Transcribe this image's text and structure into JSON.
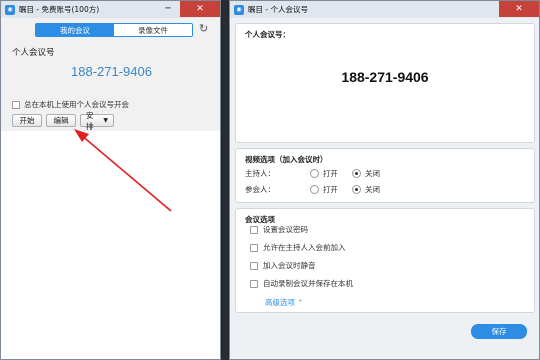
{
  "left_window": {
    "title": "瞩目 - 免费账号(100方)",
    "tabs": [
      {
        "label": "我的会议",
        "active": true
      },
      {
        "label": "录像文件",
        "active": false
      }
    ],
    "pmi_label": "个人会议号",
    "pmi_number": "188-271-9406",
    "use_pmi_checkbox": {
      "label": "总在本机上使用个人会议号开会",
      "checked": false
    },
    "buttons": {
      "start": "开始",
      "edit": "编辑",
      "schedule": "安排"
    }
  },
  "right_window": {
    "title": "瞩目 - 个人会议号",
    "pmi_section": {
      "title": "个人会议号：",
      "number": "188-271-9406"
    },
    "video_section": {
      "title": "视频选项（加入会议时）",
      "rows": [
        {
          "label": "主持人：",
          "on": "打开",
          "off": "关闭",
          "selected": "off"
        },
        {
          "label": "参会人：",
          "on": "打开",
          "off": "关闭",
          "selected": "off"
        }
      ]
    },
    "meeting_options": {
      "title": "会议选项",
      "items": [
        {
          "label": "设置会议密码",
          "checked": false
        },
        {
          "label": "允许在主持人入会前加入",
          "checked": false
        },
        {
          "label": "加入会议时静音",
          "checked": false
        },
        {
          "label": "自动录制会议并保存在本机",
          "checked": false
        }
      ],
      "advanced_link": "高级选项"
    },
    "save_button": "保存"
  },
  "colors": {
    "accent": "#2d8ce3",
    "pmi_number_left": "#3d86c6",
    "annotation_arrow": "#e02020",
    "close_button": "#c7413b"
  }
}
